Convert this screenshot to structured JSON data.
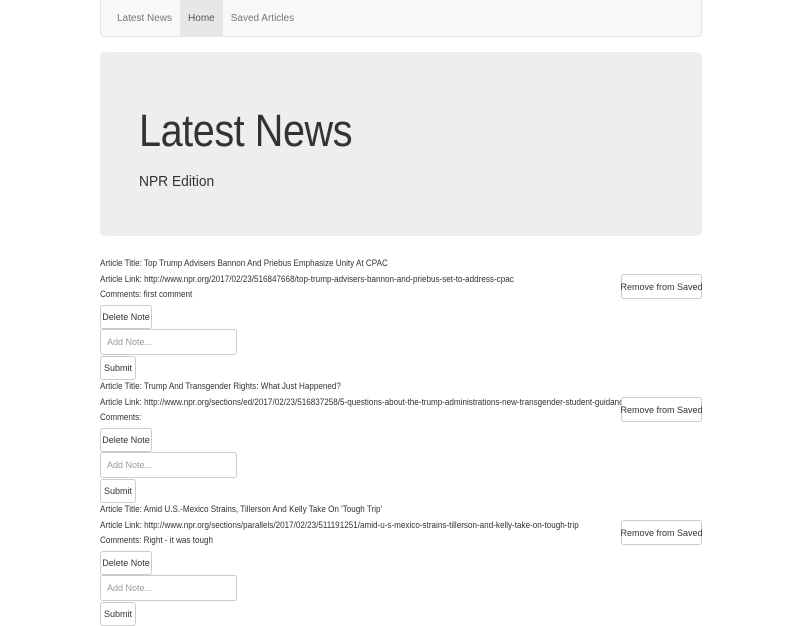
{
  "navbar": {
    "brand": "Latest News",
    "items": [
      {
        "label": "Home",
        "active": true
      },
      {
        "label": "Saved Articles",
        "active": false
      }
    ]
  },
  "jumbotron": {
    "title": "Latest News",
    "subtitle": "NPR Edition"
  },
  "labels": {
    "title_prefix": "Article Title: ",
    "link_prefix": "Article Link: ",
    "comments_prefix": "Comments: ",
    "delete_note": "Delete Note",
    "note_placeholder": "Add Note...",
    "submit": "Submit",
    "remove_saved": "Remove from Saved"
  },
  "articles": [
    {
      "title_line": "Article Title: Top Trump Advisers Bannon And Priebus Emphasize Unity At CPAC",
      "link_line": "Article Link: http://www.npr.org/2017/02/23/516847668/top-trump-advisers-bannon-and-priebus-set-to-address-cpac",
      "comments_line": "Comments: first comment"
    },
    {
      "title_line": "Article Title: Trump And Transgender Rights: What Just Happened?",
      "link_line": "Article Link: http://www.npr.org/sections/ed/2017/02/23/516837258/5-questions-about-the-trump-administrations-new-transgender-student-guidance",
      "comments_line": "Comments:"
    },
    {
      "title_line": "Article Title: Amid U.S.-Mexico Strains, Tillerson And Kelly Take On 'Tough Trip'",
      "link_line": "Article Link: http://www.npr.org/sections/parallels/2017/02/23/511191251/amid-u-s-mexico-strains-tillerson-and-kelly-take-on-tough-trip",
      "comments_line": "Comments: Right - it was tough"
    }
  ]
}
